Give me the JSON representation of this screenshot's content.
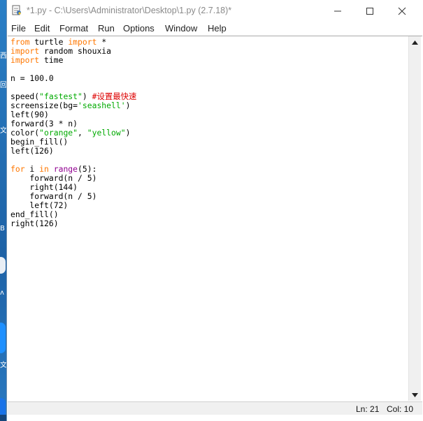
{
  "window": {
    "title": "*1.py - C:\\Users\\Administrator\\Desktop\\1.py (2.7.18)*",
    "icon": "idle-python-file-icon"
  },
  "menu": {
    "items": [
      {
        "label": "File"
      },
      {
        "label": "Edit"
      },
      {
        "label": "Format"
      },
      {
        "label": "Run"
      },
      {
        "label": "Options"
      },
      {
        "label": "Window"
      },
      {
        "label": "Help"
      }
    ]
  },
  "editor": {
    "lines": [
      [
        {
          "t": "from",
          "c": "kw"
        },
        {
          "t": " turtle "
        },
        {
          "t": "import",
          "c": "kw"
        },
        {
          "t": " *"
        }
      ],
      [
        {
          "t": "import",
          "c": "kw"
        },
        {
          "t": " random shouxia"
        }
      ],
      [
        {
          "t": "import",
          "c": "kw"
        },
        {
          "t": " time"
        }
      ],
      [],
      [
        {
          "t": "n = 100.0"
        }
      ],
      [],
      [
        {
          "t": "speed("
        },
        {
          "t": "\"fastest\"",
          "c": "str"
        },
        {
          "t": ") "
        },
        {
          "t": "#设置最快速",
          "c": "cmt"
        }
      ],
      [
        {
          "t": "screensize(bg="
        },
        {
          "t": "'seashell'",
          "c": "str"
        },
        {
          "t": ")"
        }
      ],
      [
        {
          "t": "left(90)"
        }
      ],
      [
        {
          "t": "forward(3 * n)"
        }
      ],
      [
        {
          "t": "color("
        },
        {
          "t": "\"orange\"",
          "c": "str"
        },
        {
          "t": ", "
        },
        {
          "t": "\"yellow\"",
          "c": "str"
        },
        {
          "t": ")"
        }
      ],
      [
        {
          "t": "begin_fill()"
        }
      ],
      [
        {
          "t": "left(126)"
        }
      ],
      [],
      [
        {
          "t": "for",
          "c": "kw"
        },
        {
          "t": " i "
        },
        {
          "t": "in",
          "c": "kw"
        },
        {
          "t": " "
        },
        {
          "t": "range",
          "c": "bi"
        },
        {
          "t": "(5):"
        }
      ],
      [
        {
          "t": "    forward(n / 5)"
        }
      ],
      [
        {
          "t": "    right(144)"
        }
      ],
      [
        {
          "t": "    forward(n / 5)"
        }
      ],
      [
        {
          "t": "    left(72)"
        }
      ],
      [
        {
          "t": "end_fill()"
        }
      ],
      [
        {
          "t": "right(126)"
        }
      ]
    ]
  },
  "status": {
    "line": "Ln: 21",
    "column": "Col: 10"
  },
  "desktop": {
    "fragments": [
      "西",
      "回",
      "文",
      "B",
      "ʌ",
      "文"
    ]
  },
  "colors": {
    "keyword": "#ff7700",
    "builtin": "#900090",
    "string": "#00aa00",
    "comment": "#dd0000"
  }
}
